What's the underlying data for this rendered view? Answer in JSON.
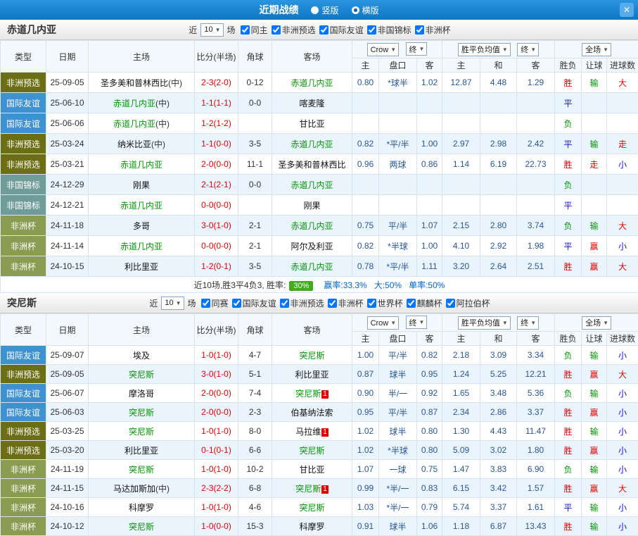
{
  "titlebar": {
    "title": "近期战绩",
    "radio_vertical": "竖版",
    "radio_horizontal": "横版",
    "close_icon": "✕"
  },
  "columns": {
    "type": "类型",
    "date": "日期",
    "home": "主场",
    "score": "比分(半场)",
    "corner": "角球",
    "away": "客场",
    "odds_home": "主",
    "odds_handicap": "盘口",
    "odds_away": "客",
    "avg_home": "主",
    "avg_draw": "和",
    "avg_away": "客",
    "result": "胜负",
    "handicap_result": "让球",
    "goals_result": "进球数"
  },
  "type_colors": {
    "非洲预选": "#6b6e14",
    "国际友谊": "#3f92d2",
    "非国锦标": "#6f9b99",
    "非洲杯": "#8a9b52"
  },
  "result_colors": {
    "red": "#e60000",
    "green": "#009900",
    "blue": "#1414cc"
  },
  "sections": [
    {
      "team": "赤道几内亚",
      "filters": {
        "near_label": "近",
        "count": "10",
        "games_label": "场",
        "checkboxes": [
          {
            "label": "同主",
            "checked": true
          },
          {
            "label": "非洲预选",
            "checked": true
          },
          {
            "label": "国际友谊",
            "checked": true
          },
          {
            "label": "非国锦标",
            "checked": true
          },
          {
            "label": "非洲杯",
            "checked": true
          }
        ]
      },
      "selects": {
        "source": "Crow",
        "time": "终",
        "avg": "胜平负均值",
        "avg_time": "终",
        "scope": "全场"
      },
      "rows": [
        {
          "type": "非洲预选",
          "date": "25-09-05",
          "home": {
            "name": "圣多美和普林西比",
            "suffix": "(中)"
          },
          "score": "2-3(2-0)",
          "corners": "0-12",
          "away": {
            "name": "赤道几内亚",
            "subject": true
          },
          "odds": {
            "home": "0.80",
            "handicap": "*球半",
            "away": "1.02"
          },
          "avg": {
            "home": "12.87",
            "draw": "4.48",
            "away": "1.29"
          },
          "results": [
            {
              "text": "胜",
              "color": "red"
            },
            {
              "text": "输",
              "color": "green"
            },
            {
              "text": "大",
              "color": "red"
            }
          ]
        },
        {
          "type": "国际友谊",
          "date": "25-06-10",
          "home": {
            "name": "赤道几内亚",
            "suffix": "(中)",
            "subject": true
          },
          "score": "1-1(1-1)",
          "corners": "0-0",
          "away": {
            "name": "喀麦隆"
          },
          "odds": null,
          "avg": null,
          "results": [
            {
              "text": "平",
              "color": "blue"
            },
            null,
            null
          ]
        },
        {
          "type": "国际友谊",
          "date": "25-06-06",
          "home": {
            "name": "赤道几内亚",
            "suffix": "(中)",
            "subject": true
          },
          "score": "1-2(1-2)",
          "corners": "",
          "away": {
            "name": "甘比亚"
          },
          "odds": null,
          "avg": null,
          "results": [
            {
              "text": "负",
              "color": "green"
            },
            null,
            null
          ]
        },
        {
          "type": "非洲预选",
          "date": "25-03-24",
          "home": {
            "name": "纳米比亚",
            "suffix": "(中)"
          },
          "score": "1-1(0-0)",
          "corners": "3-5",
          "away": {
            "name": "赤道几内亚",
            "subject": true
          },
          "odds": {
            "home": "0.82",
            "handicap": "*平/半",
            "away": "1.00"
          },
          "avg": {
            "home": "2.97",
            "draw": "2.98",
            "away": "2.42"
          },
          "results": [
            {
              "text": "平",
              "color": "blue"
            },
            {
              "text": "输",
              "color": "green"
            },
            {
              "text": "走",
              "color": "red"
            }
          ]
        },
        {
          "type": "非洲预选",
          "date": "25-03-21",
          "home": {
            "name": "赤道几内亚",
            "subject": true
          },
          "score": "2-0(0-0)",
          "corners": "11-1",
          "away": {
            "name": "圣多美和普林西比"
          },
          "odds": {
            "home": "0.96",
            "handicap": "两球",
            "away": "0.86"
          },
          "avg": {
            "home": "1.14",
            "draw": "6.19",
            "away": "22.73"
          },
          "results": [
            {
              "text": "胜",
              "color": "red"
            },
            {
              "text": "走",
              "color": "red"
            },
            {
              "text": "小",
              "color": "blue"
            }
          ]
        },
        {
          "type": "非国锦标",
          "date": "24-12-29",
          "home": {
            "name": "刚果"
          },
          "score": "2-1(2-1)",
          "corners": "0-0",
          "away": {
            "name": "赤道几内亚",
            "subject": true
          },
          "odds": null,
          "avg": null,
          "results": [
            {
              "text": "负",
              "color": "green"
            },
            null,
            null
          ]
        },
        {
          "type": "非国锦标",
          "date": "24-12-21",
          "home": {
            "name": "赤道几内亚",
            "subject": true
          },
          "score": "0-0(0-0)",
          "corners": "",
          "away": {
            "name": "刚果"
          },
          "odds": null,
          "avg": null,
          "results": [
            {
              "text": "平",
              "color": "blue"
            },
            null,
            null
          ]
        },
        {
          "type": "非洲杯",
          "date": "24-11-18",
          "home": {
            "name": "多哥"
          },
          "score": "3-0(1-0)",
          "corners": "2-1",
          "away": {
            "name": "赤道几内亚",
            "subject": true
          },
          "odds": {
            "home": "0.75",
            "handicap": "平/半",
            "away": "1.07"
          },
          "avg": {
            "home": "2.15",
            "draw": "2.80",
            "away": "3.74"
          },
          "results": [
            {
              "text": "负",
              "color": "green"
            },
            {
              "text": "输",
              "color": "green"
            },
            {
              "text": "大",
              "color": "red"
            }
          ]
        },
        {
          "type": "非洲杯",
          "date": "24-11-14",
          "home": {
            "name": "赤道几内亚",
            "subject": true
          },
          "score": "0-0(0-0)",
          "corners": "2-1",
          "away": {
            "name": "阿尔及利亚"
          },
          "odds": {
            "home": "0.82",
            "handicap": "*半球",
            "away": "1.00"
          },
          "avg": {
            "home": "4.10",
            "draw": "2.92",
            "away": "1.98"
          },
          "results": [
            {
              "text": "平",
              "color": "blue"
            },
            {
              "text": "赢",
              "color": "red"
            },
            {
              "text": "小",
              "color": "blue"
            }
          ]
        },
        {
          "type": "非洲杯",
          "date": "24-10-15",
          "home": {
            "name": "利比里亚"
          },
          "score": "1-2(0-1)",
          "corners": "3-5",
          "away": {
            "name": "赤道几内亚",
            "subject": true
          },
          "odds": {
            "home": "0.78",
            "handicap": "*平/半",
            "away": "1.11"
          },
          "avg": {
            "home": "3.20",
            "draw": "2.64",
            "away": "2.51"
          },
          "results": [
            {
              "text": "胜",
              "color": "red"
            },
            {
              "text": "赢",
              "color": "red"
            },
            {
              "text": "大",
              "color": "red"
            }
          ]
        }
      ],
      "summary": {
        "prefix": "近10场,胜3平4负3, 胜率:",
        "rate": "30%",
        "stats": [
          "赢率:33.3%",
          "大:50%",
          "单率:50%"
        ]
      }
    },
    {
      "team": "突尼斯",
      "filters": {
        "near_label": "近",
        "count": "10",
        "games_label": "场",
        "checkboxes": [
          {
            "label": "同赛",
            "checked": true
          },
          {
            "label": "国际友谊",
            "checked": true
          },
          {
            "label": "非洲预选",
            "checked": true
          },
          {
            "label": "非洲杯",
            "checked": true
          },
          {
            "label": "世界杯",
            "checked": true
          },
          {
            "label": "麒麟杯",
            "checked": true
          },
          {
            "label": "阿拉伯杯",
            "checked": true
          }
        ]
      },
      "selects": {
        "source": "Crow",
        "time": "终",
        "avg": "胜平负均值",
        "avg_time": "终",
        "scope": "全场"
      },
      "rows": [
        {
          "type": "国际友谊",
          "date": "25-09-07",
          "home": {
            "name": "埃及"
          },
          "score": "1-0(1-0)",
          "corners": "4-7",
          "away": {
            "name": "突尼斯",
            "subject": true
          },
          "odds": {
            "home": "1.00",
            "handicap": "平/半",
            "away": "0.82"
          },
          "avg": {
            "home": "2.18",
            "draw": "3.09",
            "away": "3.34"
          },
          "results": [
            {
              "text": "负",
              "color": "green"
            },
            {
              "text": "输",
              "color": "green"
            },
            {
              "text": "小",
              "color": "blue"
            }
          ]
        },
        {
          "type": "非洲预选",
          "date": "25-09-05",
          "home": {
            "name": "突尼斯",
            "subject": true
          },
          "score": "3-0(1-0)",
          "corners": "5-1",
          "away": {
            "name": "利比里亚"
          },
          "odds": {
            "home": "0.87",
            "handicap": "球半",
            "away": "0.95"
          },
          "avg": {
            "home": "1.24",
            "draw": "5.25",
            "away": "12.21"
          },
          "results": [
            {
              "text": "胜",
              "color": "red"
            },
            {
              "text": "赢",
              "color": "red"
            },
            {
              "text": "大",
              "color": "red"
            }
          ]
        },
        {
          "type": "国际友谊",
          "date": "25-06-07",
          "home": {
            "name": "摩洛哥"
          },
          "score": "2-0(0-0)",
          "corners": "7-4",
          "away": {
            "name": "突尼斯",
            "subject": true,
            "red_cards": "1"
          },
          "odds": {
            "home": "0.90",
            "handicap": "半/一",
            "away": "0.92"
          },
          "avg": {
            "home": "1.65",
            "draw": "3.48",
            "away": "5.36"
          },
          "results": [
            {
              "text": "负",
              "color": "green"
            },
            {
              "text": "输",
              "color": "green"
            },
            {
              "text": "小",
              "color": "blue"
            }
          ]
        },
        {
          "type": "国际友谊",
          "date": "25-06-03",
          "home": {
            "name": "突尼斯",
            "subject": true
          },
          "score": "2-0(0-0)",
          "corners": "2-3",
          "away": {
            "name": "伯基纳法索"
          },
          "odds": {
            "home": "0.95",
            "handicap": "平/半",
            "away": "0.87"
          },
          "avg": {
            "home": "2.34",
            "draw": "2.86",
            "away": "3.37"
          },
          "results": [
            {
              "text": "胜",
              "color": "red"
            },
            {
              "text": "赢",
              "color": "red"
            },
            {
              "text": "小",
              "color": "blue"
            }
          ]
        },
        {
          "type": "非洲预选",
          "date": "25-03-25",
          "home": {
            "name": "突尼斯",
            "subject": true
          },
          "score": "1-0(1-0)",
          "corners": "8-0",
          "away": {
            "name": "马拉维",
            "red_cards": "1"
          },
          "odds": {
            "home": "1.02",
            "handicap": "球半",
            "away": "0.80"
          },
          "avg": {
            "home": "1.30",
            "draw": "4.43",
            "away": "11.47"
          },
          "results": [
            {
              "text": "胜",
              "color": "red"
            },
            {
              "text": "输",
              "color": "green"
            },
            {
              "text": "小",
              "color": "blue"
            }
          ]
        },
        {
          "type": "非洲预选",
          "date": "25-03-20",
          "home": {
            "name": "利比里亚"
          },
          "score": "0-1(0-1)",
          "corners": "6-6",
          "away": {
            "name": "突尼斯",
            "subject": true
          },
          "odds": {
            "home": "1.02",
            "handicap": "*半球",
            "away": "0.80"
          },
          "avg": {
            "home": "5.09",
            "draw": "3.02",
            "away": "1.80"
          },
          "results": [
            {
              "text": "胜",
              "color": "red"
            },
            {
              "text": "赢",
              "color": "red"
            },
            {
              "text": "小",
              "color": "blue"
            }
          ]
        },
        {
          "type": "非洲杯",
          "date": "24-11-19",
          "home": {
            "name": "突尼斯",
            "subject": true
          },
          "score": "1-0(1-0)",
          "corners": "10-2",
          "away": {
            "name": "甘比亚"
          },
          "odds": {
            "home": "1.07",
            "handicap": "一球",
            "away": "0.75"
          },
          "avg": {
            "home": "1.47",
            "draw": "3.83",
            "away": "6.90"
          },
          "results": [
            {
              "text": "负",
              "color": "green"
            },
            {
              "text": "输",
              "color": "green"
            },
            {
              "text": "小",
              "color": "blue"
            }
          ]
        },
        {
          "type": "非洲杯",
          "date": "24-11-15",
          "home": {
            "name": "马达加斯加",
            "suffix": "(中)"
          },
          "score": "2-3(2-2)",
          "corners": "6-8",
          "away": {
            "name": "突尼斯",
            "subject": true,
            "red_cards": "1"
          },
          "odds": {
            "home": "0.99",
            "handicap": "*半/一",
            "away": "0.83"
          },
          "avg": {
            "home": "6.15",
            "draw": "3.42",
            "away": "1.57"
          },
          "results": [
            {
              "text": "胜",
              "color": "red"
            },
            {
              "text": "赢",
              "color": "red"
            },
            {
              "text": "大",
              "color": "red"
            }
          ]
        },
        {
          "type": "非洲杯",
          "date": "24-10-16",
          "home": {
            "name": "科摩罗"
          },
          "score": "1-0(1-0)",
          "corners": "4-6",
          "away": {
            "name": "突尼斯",
            "subject": true
          },
          "odds": {
            "home": "1.03",
            "handicap": "*半/一",
            "away": "0.79"
          },
          "avg": {
            "home": "5.74",
            "draw": "3.37",
            "away": "1.61"
          },
          "results": [
            {
              "text": "平",
              "color": "blue"
            },
            {
              "text": "输",
              "color": "green"
            },
            {
              "text": "小",
              "color": "blue"
            }
          ]
        },
        {
          "type": "非洲杯",
          "date": "24-10-12",
          "home": {
            "name": "突尼斯",
            "subject": true
          },
          "score": "1-0(0-0)",
          "corners": "15-3",
          "away": {
            "name": "科摩罗"
          },
          "odds": {
            "home": "0.91",
            "handicap": "球半",
            "away": "1.06"
          },
          "avg": {
            "home": "1.18",
            "draw": "6.87",
            "away": "13.43"
          },
          "results": [
            {
              "text": "胜",
              "color": "red"
            },
            {
              "text": "输",
              "color": "green"
            },
            {
              "text": "小",
              "color": "blue"
            }
          ]
        }
      ],
      "summary": null
    }
  ]
}
